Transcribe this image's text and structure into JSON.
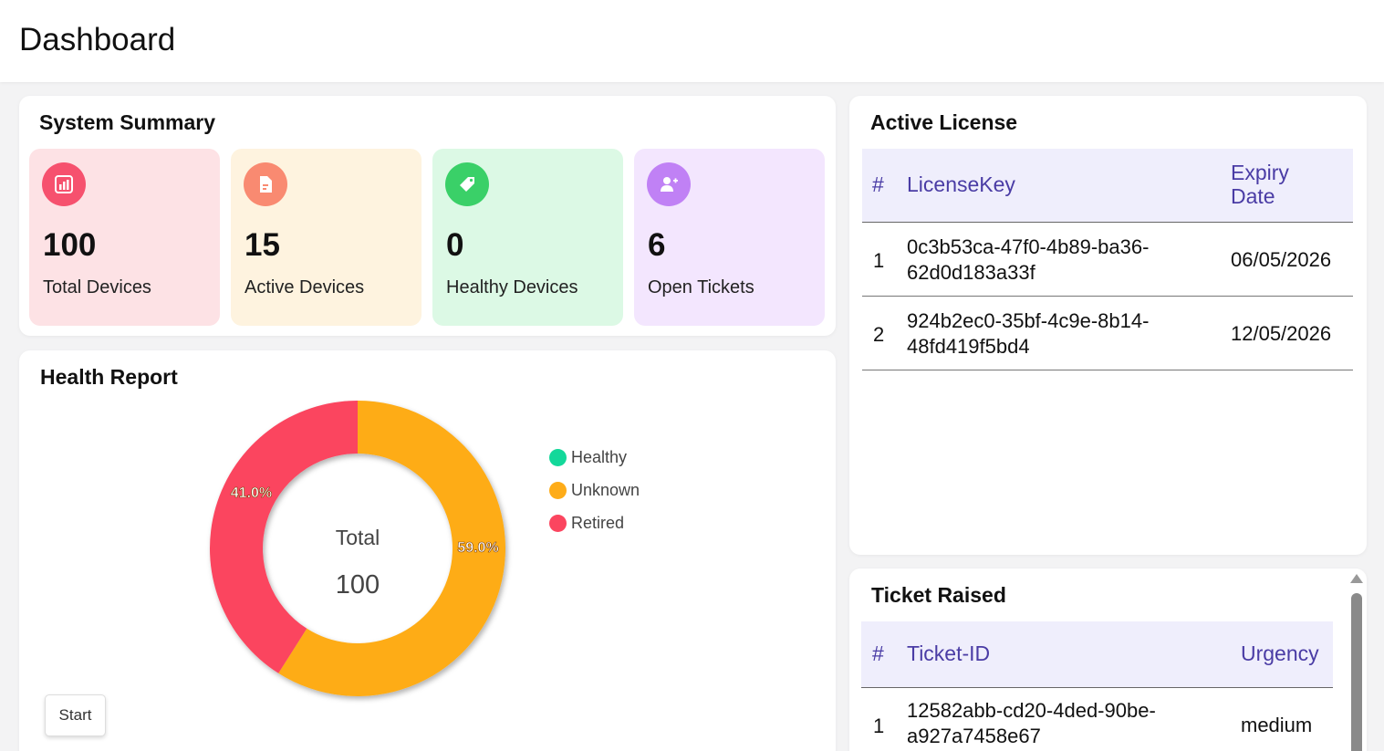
{
  "header": {
    "title": "Dashboard"
  },
  "summary": {
    "title": "System Summary",
    "stats": [
      {
        "value": "100",
        "label": "Total Devices",
        "bg": "#fde2e5",
        "icon_bg": "#f6516e",
        "icon": "bar-chart-icon"
      },
      {
        "value": "15",
        "label": "Active Devices",
        "bg": "#fef3df",
        "icon_bg": "#f98a71",
        "icon": "document-icon"
      },
      {
        "value": "0",
        "label": "Healthy Devices",
        "bg": "#dcf9e5",
        "icon_bg": "#3ad068",
        "icon": "tag-icon"
      },
      {
        "value": "6",
        "label": "Open Tickets",
        "bg": "#f3e6fe",
        "icon_bg": "#c081f5",
        "icon": "add-user-icon"
      }
    ]
  },
  "health": {
    "title": "Health Report",
    "center_label": "Total",
    "center_value": "100",
    "start_label": "Start"
  },
  "chart_data": {
    "type": "pie",
    "categories": [
      "Healthy",
      "Unknown",
      "Retired"
    ],
    "values": [
      0,
      59.0,
      41.0
    ],
    "colors": [
      "#13d89a",
      "#feac18",
      "#fb455f"
    ],
    "value_labels": [
      "",
      "59.0%",
      "41.0%"
    ],
    "legend": "right"
  },
  "license": {
    "title": "Active License",
    "columns": [
      "#",
      "LicenseKey",
      "Expiry Date"
    ],
    "rows": [
      {
        "n": "1",
        "key_line1": "0c3b53ca-47f0-4b89-ba36-",
        "key_line2": "62d0d183a33f",
        "expiry": "06/05/2026"
      },
      {
        "n": "2",
        "key_line1": "924b2ec0-35bf-4c9e-8b14-",
        "key_line2": "48fd419f5bd4",
        "expiry": "12/05/2026"
      }
    ]
  },
  "tickets": {
    "title": "Ticket Raised",
    "columns": [
      "#",
      "Ticket-ID",
      "Urgency"
    ],
    "rows": [
      {
        "n": "1",
        "id_line1": "12582abb-cd20-4ded-90be-",
        "id_line2": "a927a7458e67",
        "urgency": "medium"
      }
    ]
  }
}
